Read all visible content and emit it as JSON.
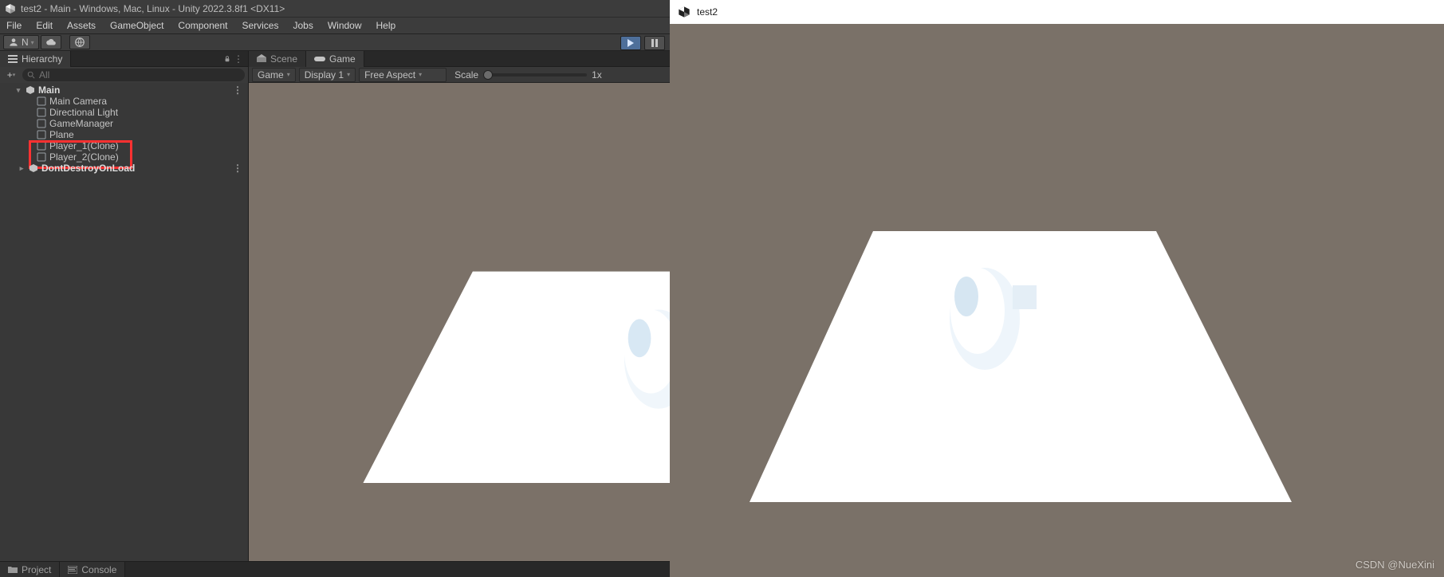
{
  "window_title": "test2 - Main - Windows, Mac, Linux - Unity 2022.3.8f1 <DX11>",
  "menu": {
    "file": "File",
    "edit": "Edit",
    "assets": "Assets",
    "gameobject": "GameObject",
    "component": "Component",
    "services": "Services",
    "jobs": "Jobs",
    "window": "Window",
    "help": "Help"
  },
  "toolbar": {
    "account_dd_label": "N",
    "cloud_icon": "cloud-icon",
    "store_icon": "store-icon"
  },
  "play_controls": {
    "play_active": true
  },
  "hierarchy": {
    "panel_title": "Hierarchy",
    "search_placeholder": "All",
    "scene_name": "Main",
    "items": [
      {
        "label": "Main Camera"
      },
      {
        "label": "Directional Light"
      },
      {
        "label": "GameManager"
      },
      {
        "label": "Plane"
      },
      {
        "label": "Player_1(Clone)"
      },
      {
        "label": "Player_2(Clone)"
      }
    ],
    "dont_destroy": "DontDestroyOnLoad"
  },
  "view": {
    "scene_tab": "Scene",
    "game_tab": "Game",
    "dd_game": "Game",
    "dd_display": "Display 1",
    "dd_aspect": "Free Aspect",
    "scale_label": "Scale",
    "scale_value": "1x"
  },
  "bottom": {
    "project": "Project",
    "console": "Console"
  },
  "game_window": {
    "title": "test2"
  },
  "watermark": "CSDN @NueXini"
}
